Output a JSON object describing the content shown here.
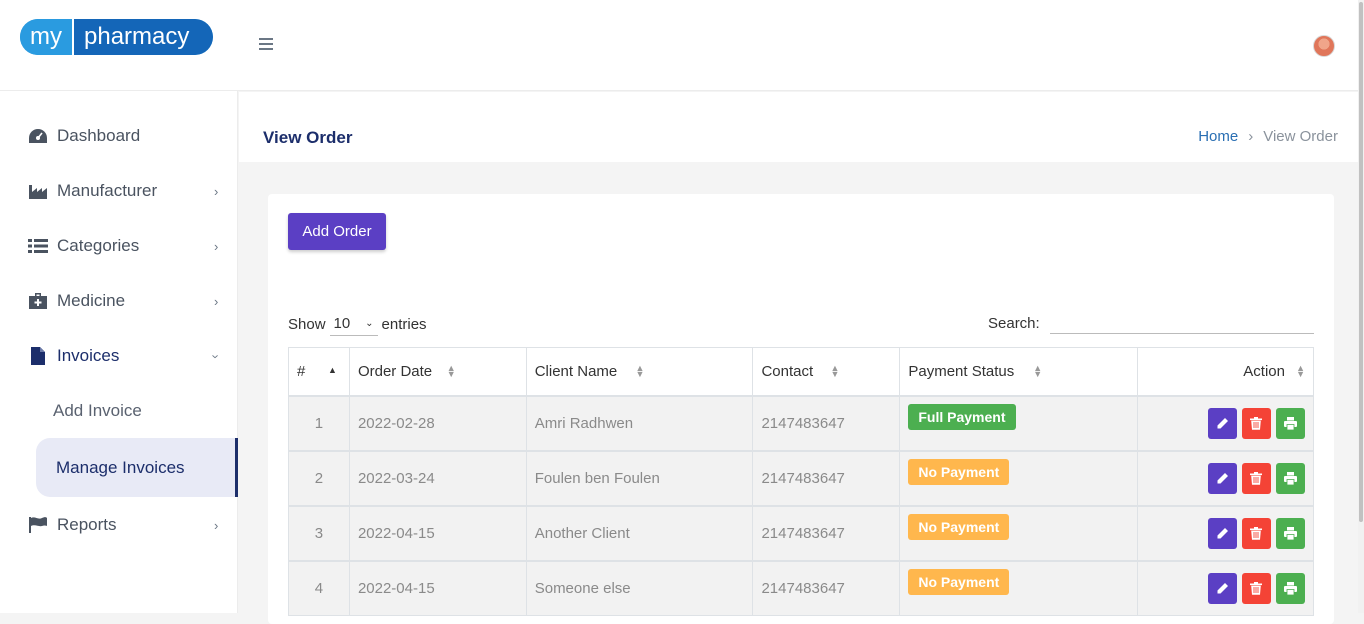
{
  "header": {
    "logo_my": "my",
    "logo_pharmacy": "pharmacy"
  },
  "sidebar": {
    "items": [
      {
        "label": "Dashboard",
        "icon": "dashboard-icon"
      },
      {
        "label": "Manufacturer",
        "icon": "factory-icon"
      },
      {
        "label": "Categories",
        "icon": "list-icon"
      },
      {
        "label": "Medicine",
        "icon": "medical-kit-icon"
      },
      {
        "label": "Invoices",
        "icon": "file-icon"
      },
      {
        "label": "Reports",
        "icon": "flag-icon"
      }
    ],
    "sub_items": [
      {
        "label": "Add Invoice"
      },
      {
        "label": "Manage Invoices"
      }
    ]
  },
  "page": {
    "title": "View Order",
    "breadcrumb_home": "Home",
    "breadcrumb_current": "View Order"
  },
  "card": {
    "add_button": "Add Order",
    "show_label": "Show",
    "entries_value": "10",
    "entries_label": "entries",
    "search_label": "Search:"
  },
  "table": {
    "columns": [
      "#",
      "Order Date",
      "Client Name",
      "Contact",
      "Payment Status",
      "Action"
    ],
    "rows": [
      {
        "idx": "1",
        "date": "2022-02-28",
        "client": "Amri Radhwen",
        "contact": "2147483647",
        "status": "Full Payment"
      },
      {
        "idx": "2",
        "date": "2022-03-24",
        "client": "Foulen ben Foulen",
        "contact": "2147483647",
        "status": "No Payment"
      },
      {
        "idx": "3",
        "date": "2022-04-15",
        "client": "Another Client",
        "contact": "2147483647",
        "status": "No Payment"
      },
      {
        "idx": "4",
        "date": "2022-04-15",
        "client": "Someone else",
        "contact": "2147483647",
        "status": "No Payment"
      }
    ]
  },
  "colors": {
    "primary": "#5b3fc4",
    "success": "#4caf50",
    "danger": "#f44336",
    "warning": "#ffb74d",
    "nav_active": "#1c2e6b"
  }
}
